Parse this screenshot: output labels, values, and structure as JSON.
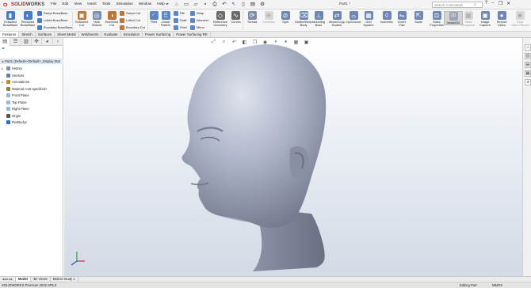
{
  "app": {
    "name_left": "SOLID",
    "name_right": "WORKS",
    "menu": [
      "File",
      "Edit",
      "View",
      "Insert",
      "Tools",
      "Simulation",
      "Window",
      "Help"
    ],
    "doc_title": "Part1 *",
    "search_placeholder": "Search Commands"
  },
  "ribbon": {
    "big_buttons_left": [
      {
        "label_1": "Extruded",
        "label_2": "Boss/Base",
        "color": "#4a7cc4"
      },
      {
        "label_1": "Revolved",
        "label_2": "Boss/Base",
        "color": "#4a7cc4"
      }
    ],
    "small_group_1": [
      {
        "label": "Swept Boss/Base",
        "color": "#4a7cc4"
      },
      {
        "label": "Lofted Boss/Base",
        "color": "#4a7cc4"
      },
      {
        "label": "Boundary Boss/Base",
        "color": "#4a7cc4"
      }
    ],
    "big_buttons_cut": [
      {
        "label_1": "Extruded",
        "label_2": "Cut",
        "color": "#b8763a"
      },
      {
        "label_1": "Hole",
        "label_2": "Wizard",
        "color": "#7a8fb0"
      },
      {
        "label_1": "Revolved",
        "label_2": "Cut",
        "color": "#b8763a"
      }
    ],
    "small_group_2": [
      {
        "label": "Swept Cut",
        "color": "#b8763a"
      },
      {
        "label": "Lofted Cut",
        "color": "#b8763a"
      },
      {
        "label": "Boundary Cut",
        "color": "#b8763a"
      }
    ],
    "fillet": {
      "label": "Fillet",
      "color": "#5d86c3"
    },
    "linear_pattern": {
      "label_1": "Linear",
      "label_2": "Pattern",
      "color": "#5d86c3"
    },
    "small_group_3": [
      {
        "label": "Rib",
        "color": "#5d86c3"
      },
      {
        "label": "Draft",
        "color": "#5d86c3"
      },
      {
        "label": "Shell",
        "color": "#5d86c3"
      }
    ],
    "small_group_4": [
      {
        "label": "Wrap",
        "color": "#5d86c3"
      },
      {
        "label": "Intersect",
        "color": "#5d86c3"
      },
      {
        "label": "Mirror",
        "color": "#5d86c3"
      }
    ],
    "reference_geometry": {
      "label_1": "Reference",
      "label_2": "Geometry",
      "color": "#6b6b6b"
    },
    "curves": {
      "label": "Curves",
      "color": "#6b6b6b"
    },
    "right_buttons": [
      {
        "label_1": "Thread",
        "label_2": "",
        "color": "#7d8ea9",
        "disabled": false
      },
      {
        "label_1": "Combine",
        "label_2": "",
        "color": "#aaaaaa",
        "disabled": true
      },
      {
        "label_1": "Split",
        "label_2": "",
        "color": "#6c87b1",
        "disabled": false
      },
      {
        "label_1": "Delete/Keep",
        "label_2": "Body",
        "color": "#6c87b1",
        "disabled": false
      },
      {
        "label_1": "Mounting",
        "label_2": "Boss",
        "color": "#6c87b1",
        "disabled": false
      },
      {
        "label_1": "Move/Copy",
        "label_2": "Bodies",
        "color": "#6c87b1",
        "disabled": false
      },
      {
        "label_1": "Lip/Groove",
        "label_2": "",
        "color": "#6c87b1",
        "disabled": false
      },
      {
        "label_1": "Grid",
        "label_2": "System",
        "color": "#6c87b1",
        "disabled": false
      },
      {
        "label_1": "Isometric",
        "label_2": "",
        "color": "#6c87b1",
        "disabled": false
      },
      {
        "label_1": "Invert",
        "label_2": "Part",
        "color": "#6c87b1",
        "disabled": false
      },
      {
        "label_1": "Scale",
        "label_2": "",
        "color": "#6c87b1",
        "disabled": false
      },
      {
        "label_1": "Mass",
        "label_2": "Properties",
        "color": "#6c87b1",
        "disabled": false
      },
      {
        "label_1": "Instant3D",
        "label_2": "",
        "color": "#9aa5b5",
        "disabled": false
      },
      {
        "label_1": "Table",
        "label_2": "Snapshot",
        "color": "#aaaaaa",
        "disabled": true
      },
      {
        "label_1": "Image",
        "label_2": "Capture",
        "color": "#6c87b1",
        "disabled": false
      },
      {
        "label_1": "Record",
        "label_2": "Video",
        "color": "#6c87b1",
        "disabled": false
      },
      {
        "label_1": "Stop",
        "label_2": "Video Record",
        "color": "#aaaaaa",
        "disabled": true
      }
    ]
  },
  "feature_tabs": [
    "Features",
    "Sketch",
    "Surfaces",
    "Sheet Metal",
    "Weldments",
    "Evaluate",
    "Simulation",
    "Power Surfacing",
    "Power Surfacing RE"
  ],
  "feature_tabs_active": 0,
  "tree": {
    "root": "Part1 (Default<<Default>_Display Stat",
    "items": [
      {
        "label": "History",
        "color": "#7a8fb0",
        "expander": "▸"
      },
      {
        "label": "Sensors",
        "color": "#5f7fad",
        "expander": ""
      },
      {
        "label": "Annotations",
        "color": "#c78a2a",
        "expander": "▸"
      },
      {
        "label": "Material <not specified>",
        "color": "#8e7d4f",
        "expander": ""
      },
      {
        "label": "Front Plane",
        "color": "#9bb6db",
        "expander": ""
      },
      {
        "label": "Top Plane",
        "color": "#9bb6db",
        "expander": ""
      },
      {
        "label": "Right Plane",
        "color": "#9bb6db",
        "expander": ""
      },
      {
        "label": "Origin",
        "color": "#555555",
        "expander": ""
      },
      {
        "label": "PwrBody1",
        "color": "#2f6fbf",
        "expander": ""
      }
    ]
  },
  "bottom_tabs": [
    "Model",
    "3D Views",
    "Motion Study 1"
  ],
  "bottom_tabs_active": 0,
  "status": {
    "version": "SOLIDWORKS Premium 2018 SP5.0",
    "mode": "Editing Part",
    "units": "MMGS"
  },
  "icons": {
    "ds_logo": "ds-logo-icon",
    "home": "home-icon",
    "new": "new-icon",
    "open": "open-icon",
    "save": "save-icon",
    "print": "print-icon",
    "undo": "undo-icon",
    "select": "select-icon",
    "rebuild": "rebuild-icon",
    "options": "options-icon"
  },
  "colors": {
    "accent": "#2a62b8",
    "brand_red": "#c8102e",
    "model_gray": "#a7aec2"
  }
}
